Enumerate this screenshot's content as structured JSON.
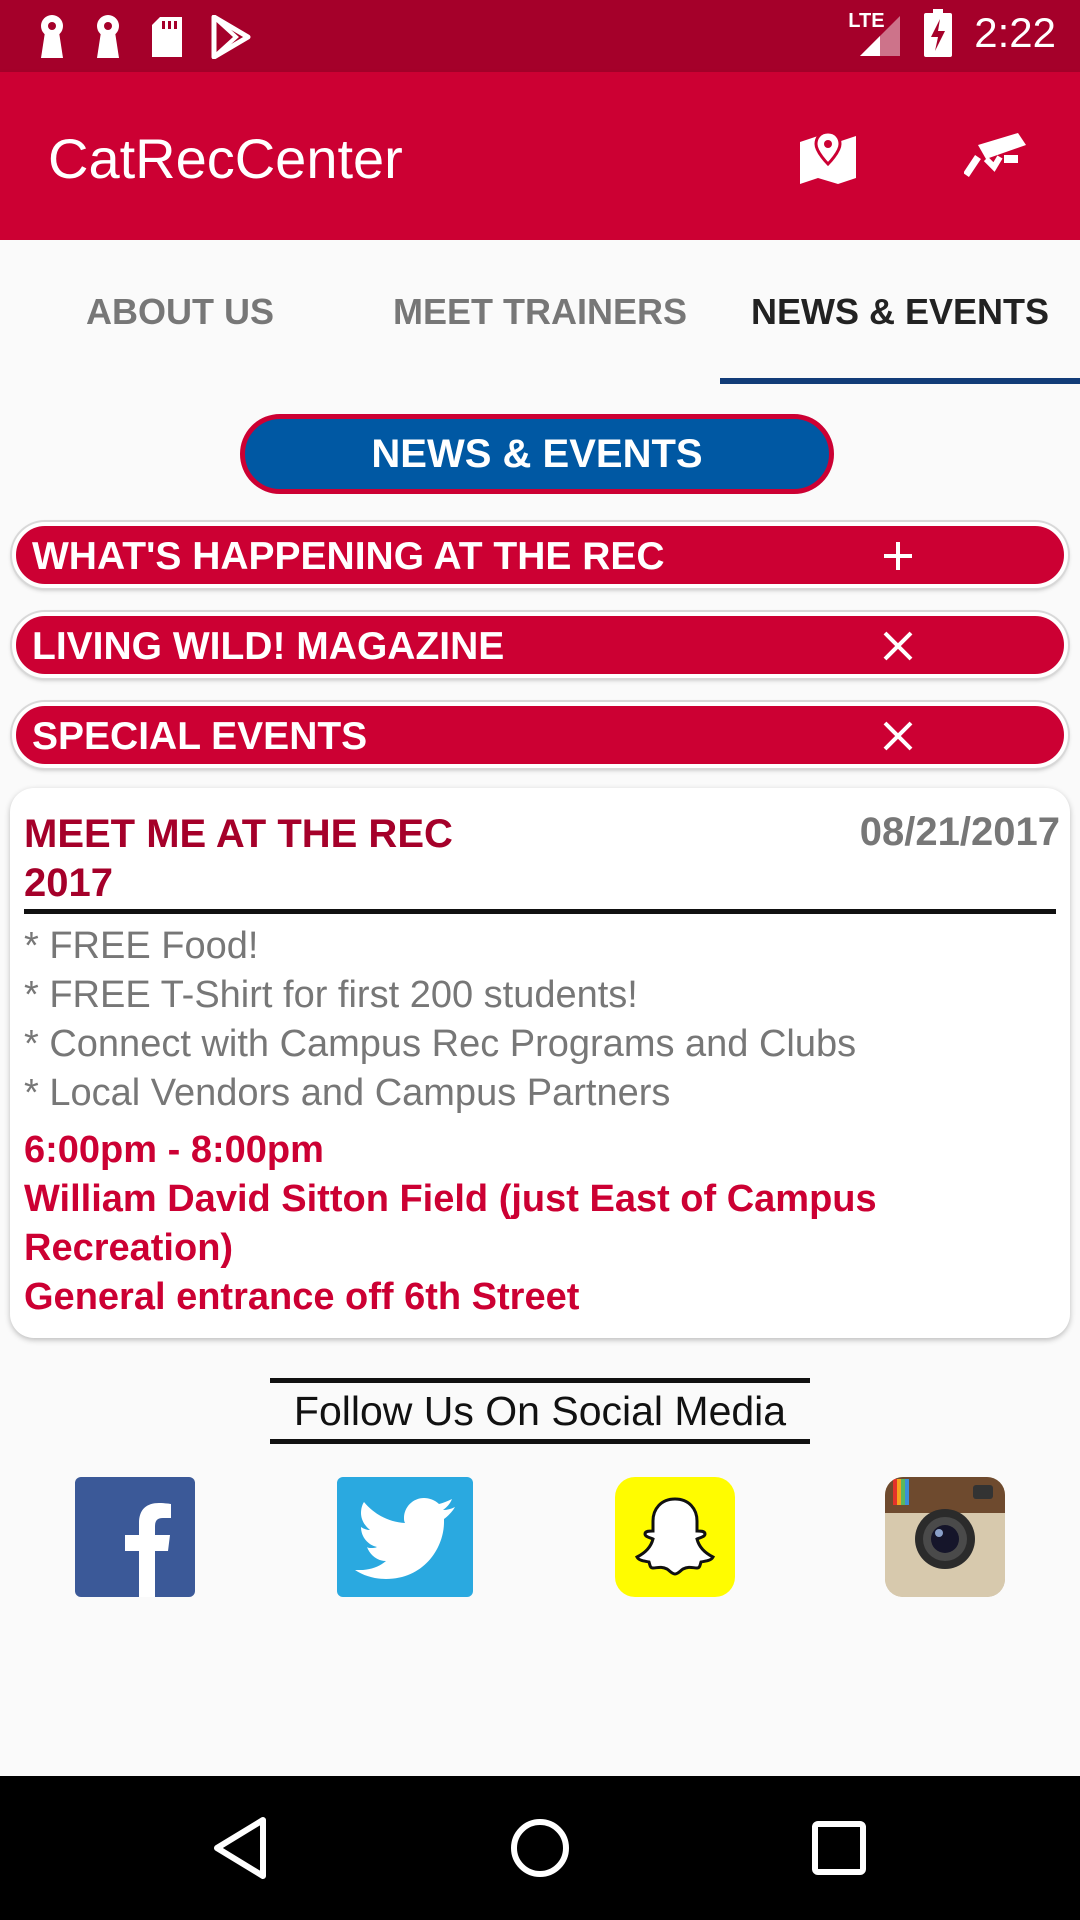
{
  "status_bar": {
    "time": "2:22",
    "network": "LTE",
    "icons": [
      "keyhole-icon",
      "keyhole-icon",
      "sd-card-icon",
      "play-store-icon",
      "signal-icon",
      "battery-charging-icon"
    ]
  },
  "app_bar": {
    "title": "CatRecCenter",
    "actions": [
      "map-icon",
      "camera-icon"
    ],
    "color": "#cc0033"
  },
  "tabs": [
    {
      "label": "ABOUT US",
      "active": false
    },
    {
      "label": "MEET TRAINERS",
      "active": false
    },
    {
      "label": "NEWS & EVENTS",
      "active": true
    }
  ],
  "section_title": "NEWS & EVENTS",
  "accordion": [
    {
      "label": "WHAT'S HAPPENING AT THE REC",
      "icon": "plus-icon"
    },
    {
      "label": "LIVING WILD! MAGAZINE",
      "icon": "close-icon"
    },
    {
      "label": "SPECIAL EVENTS",
      "icon": "close-icon"
    }
  ],
  "event": {
    "title": "MEET ME AT THE REC 2017",
    "date": "08/21/2017",
    "bullets": [
      "* FREE Food!",
      "* FREE T-Shirt for first 200 students!",
      "* Connect with Campus Rec Programs and Clubs",
      "* Local Vendors and Campus Partners"
    ],
    "time": "6:00pm - 8:00pm",
    "location": "William David Sitton Field (just East of Campus Recreation)",
    "entrance": "General entrance off 6th Street"
  },
  "social": {
    "heading": "Follow Us On Social Media",
    "links": [
      "facebook-icon",
      "twitter-icon",
      "snapchat-icon",
      "instagram-icon"
    ]
  },
  "colors": {
    "status_bar": "#a5002a",
    "primary": "#cc0033",
    "accent_blue": "#0058a3",
    "tab_indicator": "#123c78"
  }
}
